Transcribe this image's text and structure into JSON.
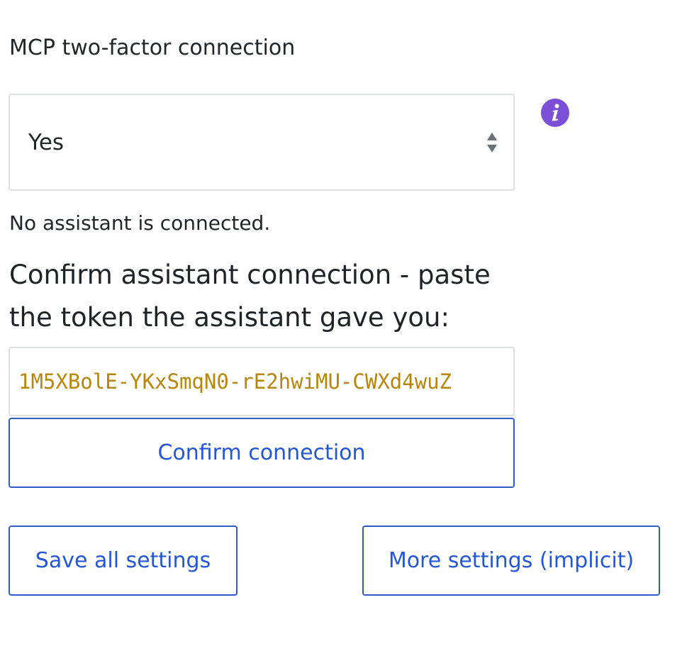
{
  "section": {
    "title": "MCP two-factor connection"
  },
  "select": {
    "value": "Yes",
    "arrows_icon": "up-down-arrows-icon"
  },
  "info": {
    "icon": "info-icon",
    "color": "#7b4fd6"
  },
  "status": {
    "text": "No assistant is connected."
  },
  "prompt": {
    "text": "Confirm assistant connection - paste the token the assistant gave you:"
  },
  "token": {
    "value": "1M5XBolE-YKxSmqN0-rE2hwiMU-CWXd4wuZ",
    "color": "#b8860b"
  },
  "buttons": {
    "confirm_label": "Confirm connection",
    "save_label": "Save all settings",
    "more_label": "More settings (implicit)",
    "accent_color": "#2357d4"
  }
}
